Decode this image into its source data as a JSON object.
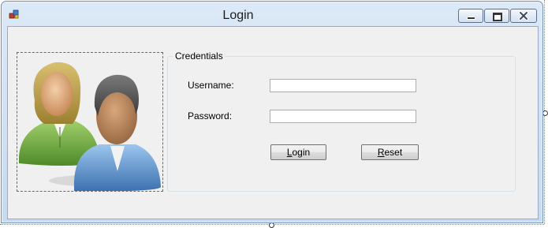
{
  "window": {
    "title": "Login",
    "icon": "application-icon",
    "controls": [
      "minimize-icon",
      "restore-icon",
      "close-icon"
    ]
  },
  "picture": {
    "icon": "users-icon"
  },
  "credentials": {
    "legend": "Credentials",
    "username_label": "Username:",
    "username_value": "",
    "password_label": "Password:",
    "password_value": ""
  },
  "buttons": {
    "login": {
      "accel": "L",
      "rest": "ogin"
    },
    "reset": {
      "accel": "R",
      "rest": "eset"
    }
  },
  "colors": {
    "title_bar": "#dce9f7",
    "client_bg": "#f0f0f0",
    "close_glyph": "#3c4a61"
  }
}
